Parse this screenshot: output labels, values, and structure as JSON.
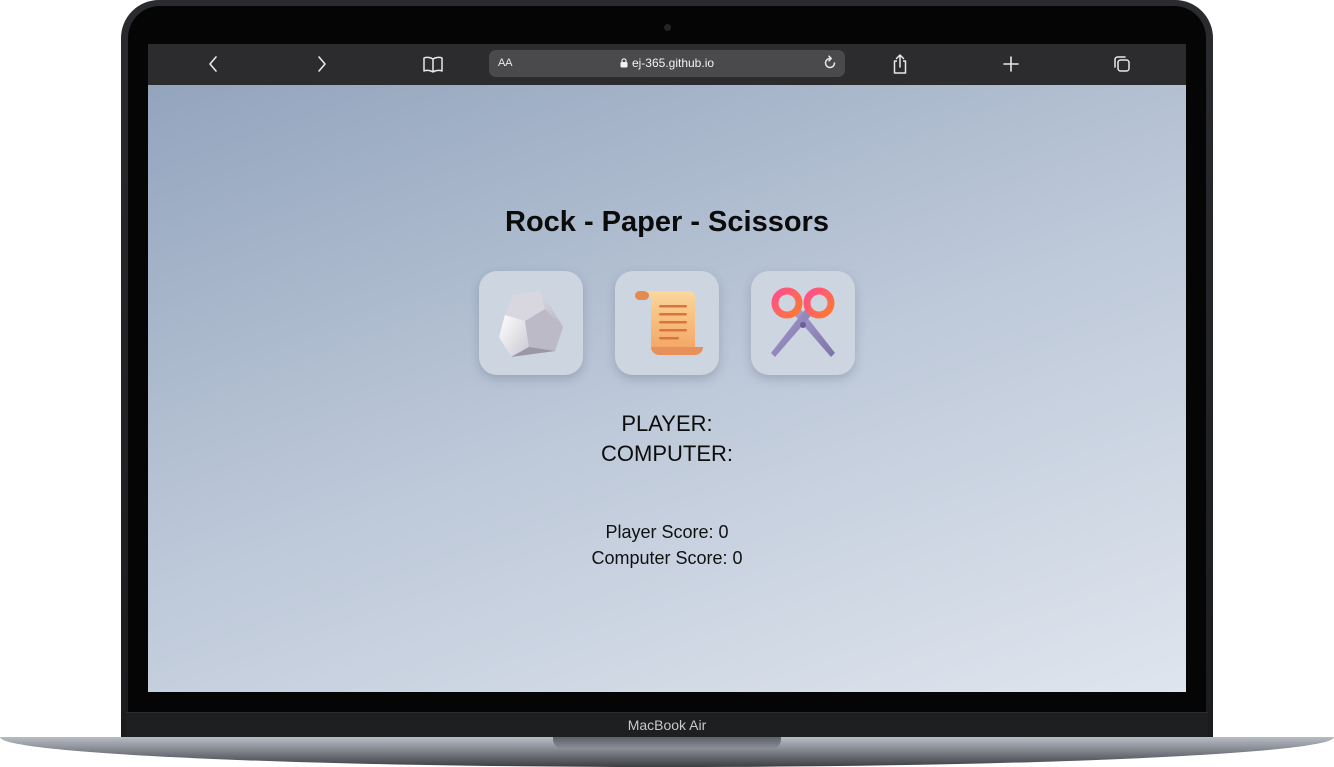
{
  "device": {
    "model_label": "MacBook Air"
  },
  "browser": {
    "text_size_button": "AA",
    "url": "ej-365.github.io",
    "icons": [
      "back-icon",
      "forward-icon",
      "bookmarks-icon",
      "lock-icon",
      "reload-icon",
      "share-icon",
      "new-tab-icon",
      "tabs-icon"
    ]
  },
  "game": {
    "title": "Rock - Paper - Scissors",
    "choices": [
      {
        "name": "rock",
        "icon": "rock-icon"
      },
      {
        "name": "paper",
        "icon": "paper-scroll-icon"
      },
      {
        "name": "scissors",
        "icon": "scissors-icon"
      }
    ],
    "player_label": "PLAYER:",
    "computer_label": "COMPUTER:",
    "player_score_text": "Player Score: 0",
    "computer_score_text": "Computer Score: 0"
  },
  "colors": {
    "background_start": "#93a4bd",
    "background_end": "#dfe5ee",
    "card": "#cdd5e1",
    "toolbar": "#2c2c2e"
  }
}
